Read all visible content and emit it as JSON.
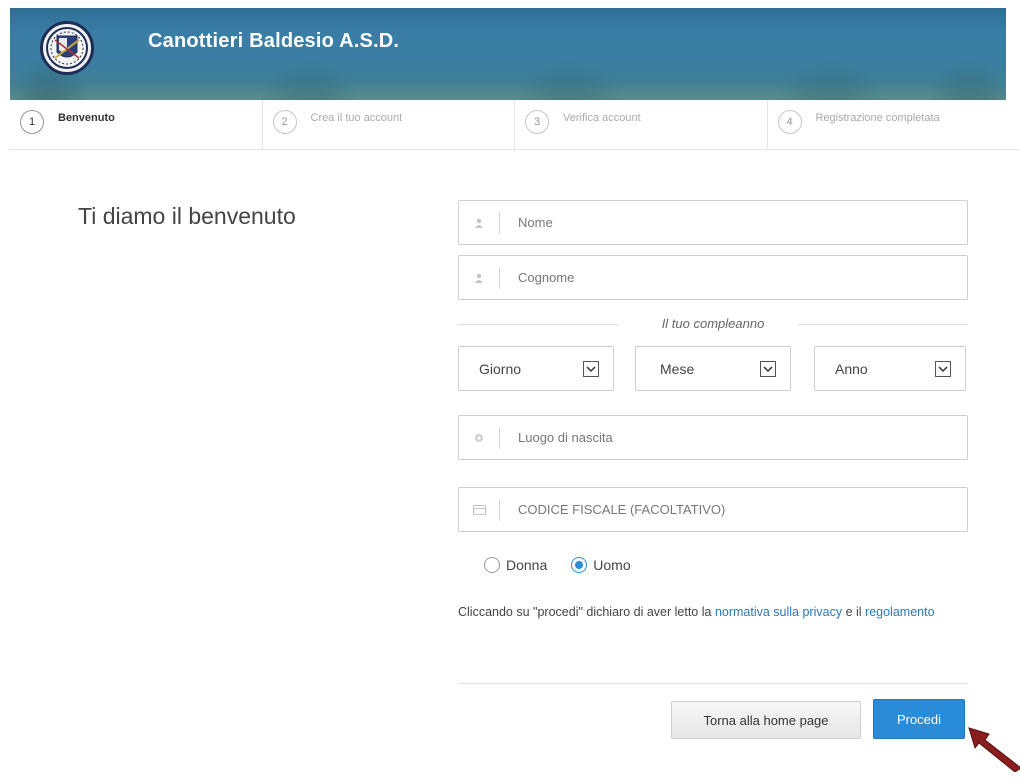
{
  "header": {
    "brand": "Canottieri Baldesio A.S.D."
  },
  "steps": [
    {
      "num": "1",
      "label": "Benvenuto",
      "active": true
    },
    {
      "num": "2",
      "label": "Crea il tuo account",
      "active": false
    },
    {
      "num": "3",
      "label": "Verifica account",
      "active": false
    },
    {
      "num": "4",
      "label": "Registrazione completata",
      "active": false
    }
  ],
  "form": {
    "welcome": "Ti diamo il benvenuto",
    "nome_placeholder": "Nome",
    "cognome_placeholder": "Cognome",
    "birthday_label": "Il tuo compleanno",
    "giorno": "Giorno",
    "mese": "Mese",
    "anno": "Anno",
    "luogo_placeholder": "Luogo di nascita",
    "cf_placeholder": "CODICE FISCALE (FACOLTATIVO)",
    "gender": {
      "donna": "Donna",
      "uomo": "Uomo",
      "selected": "Uomo"
    },
    "legal_prefix": "Cliccando su \"procedi\" dichiaro di aver letto la",
    "legal_link1": "normativa sulla privacy",
    "legal_and": "e il",
    "legal_link2": "regolamento",
    "home_button": "Torna alla home page",
    "proceed_button": "Procedi"
  },
  "colors": {
    "accent": "#2a8bd8",
    "link": "#2a78b8"
  }
}
